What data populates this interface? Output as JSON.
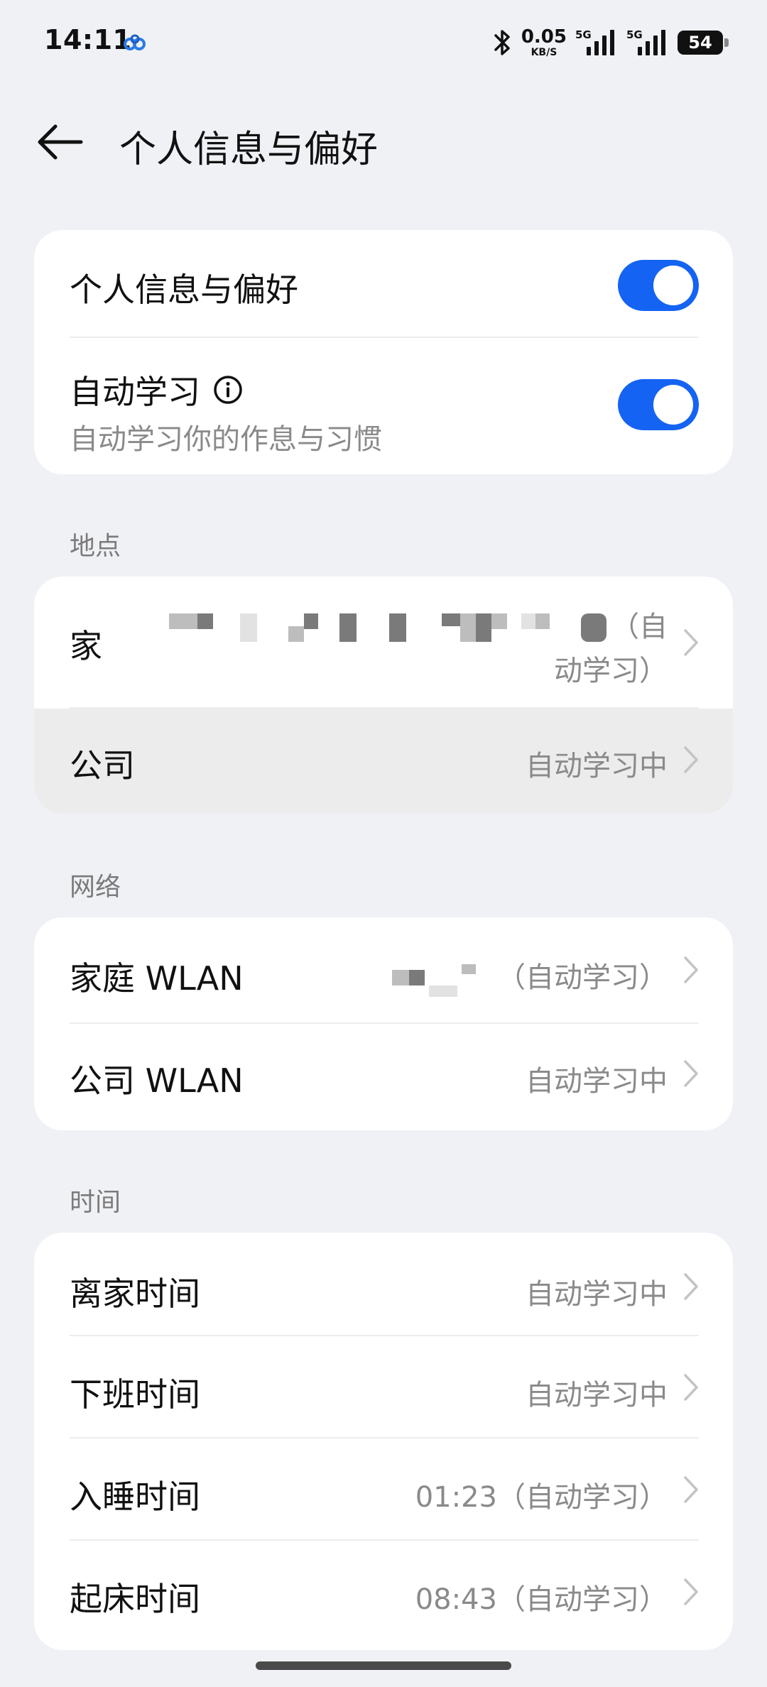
{
  "status_bar": {
    "time": "14:11",
    "net_speed": "0.05",
    "net_unit": "KB/S",
    "sig1_type": "5G",
    "sig2_type": "5G",
    "battery": "54",
    "icons": [
      "app-cloud-icon",
      "bluetooth-icon",
      "signal-icon",
      "battery-icon"
    ]
  },
  "header": {
    "title": "个人信息与偏好"
  },
  "card1": {
    "pref_label": "个人信息与偏好",
    "auto_label": "自动学习",
    "auto_sub": "自动学习你的作息与习惯",
    "pref_on": true,
    "auto_on": true
  },
  "location": {
    "section": "地点",
    "home_label": "家",
    "home_value_line1": "（自",
    "home_value_line2": "动学习）",
    "company_label": "公司",
    "company_value": "自动学习中"
  },
  "network": {
    "section": "网络",
    "home_wlan_label": "家庭 WLAN",
    "home_wlan_value": "（自动学习）",
    "company_wlan_label": "公司 WLAN",
    "company_wlan_value": "自动学习中"
  },
  "time": {
    "section": "时间",
    "leave_label": "离家时间",
    "leave_value": "自动学习中",
    "offwork_label": "下班时间",
    "offwork_value": "自动学习中",
    "sleep_label": "入睡时间",
    "sleep_value": "01:23（自动学习）",
    "wake_label": "起床时间",
    "wake_value": "08:43（自动学习）"
  },
  "colors": {
    "accent": "#1463f3",
    "background": "#f0f1f5",
    "pressed_row": "#ececec"
  }
}
